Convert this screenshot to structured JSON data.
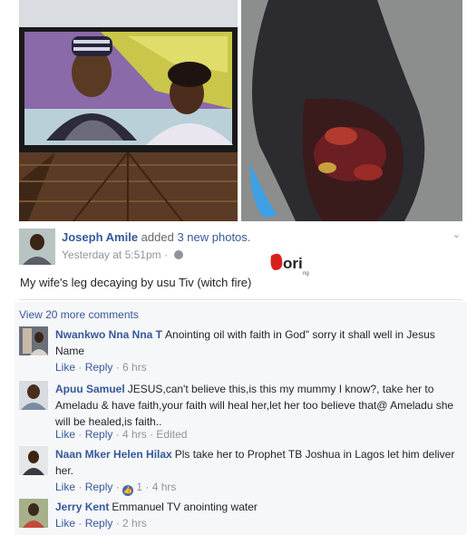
{
  "post": {
    "author": "Joseph Amile",
    "action_prefix": "added",
    "action_highlight": "3 new photos",
    "action_suffix": ".",
    "timestamp": "Yesterday at 5:51pm",
    "meta_sep": "·",
    "text": "My wife's leg decaying by usu Tiv (witch fire)",
    "menu_icon": "chevron-down-icon",
    "privacy_icon": "globe-icon"
  },
  "watermark": {
    "text": "ori",
    "sub": "ng"
  },
  "comments_header": {
    "view_more": "View 20 more comments"
  },
  "comments": [
    {
      "name": "Nwankwo Nna Nna T",
      "text": "Anointing oil with faith in God\" sorry it shall well in Jesus Name",
      "like": "Like",
      "reply": "Reply",
      "time": "6 hrs",
      "edited": ""
    },
    {
      "name": "Apuu Samuel",
      "text": "JESUS,can't believe this,is this my mummy I know?, take her to Ameladu & have faith,your faith will heal her,let her too believe that@ Ameladu she will be healed,is faith..",
      "like": "Like",
      "reply": "Reply",
      "time": "4 hrs",
      "edited": "Edited"
    },
    {
      "name": "Naan Mker Helen Hilax",
      "text": "Pls take her to Prophet TB Joshua in Lagos let him deliver her.",
      "like": "Like",
      "reply": "Reply",
      "like_count": "1",
      "time": "4 hrs",
      "edited": ""
    },
    {
      "name": "Jerry Kent",
      "text": "Emmanuel TV anointing water",
      "like": "Like",
      "reply": "Reply",
      "time": "2 hrs",
      "edited": ""
    }
  ],
  "colors": {
    "link": "#365899",
    "meta": "#90949c",
    "text": "#1d2129"
  }
}
